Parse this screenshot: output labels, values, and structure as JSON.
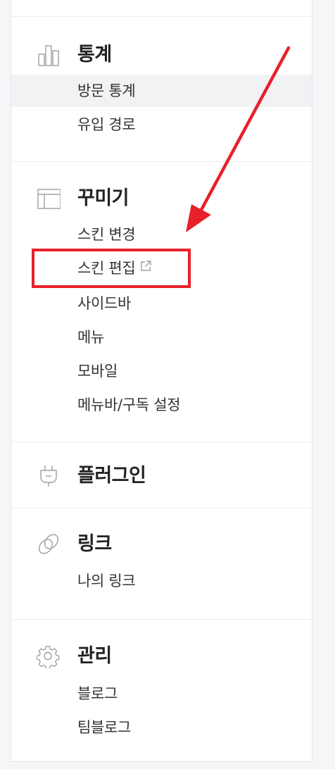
{
  "sections": [
    {
      "title": "통계",
      "icon": "bar-chart-icon",
      "items": [
        "방문 통계",
        "유입 경로"
      ]
    },
    {
      "title": "꾸미기",
      "icon": "layout-icon",
      "items": [
        "스킨 변경",
        "스킨 편집",
        "사이드바",
        "메뉴",
        "모바일",
        "메뉴바/구독 설정"
      ]
    },
    {
      "title": "플러그인",
      "icon": "plug-icon",
      "items": []
    },
    {
      "title": "링크",
      "icon": "link-icon",
      "items": [
        "나의 링크"
      ]
    },
    {
      "title": "관리",
      "icon": "gear-icon",
      "items": [
        "블로그",
        "팀블로그"
      ]
    }
  ],
  "colors": {
    "annotation": "#e8202a",
    "active_row": "#f1f2f4",
    "text": "#333333",
    "icon": "#9aa0a6"
  },
  "annotation": {
    "highlighted_item": "스킨 편집",
    "has_external_link_icon": true
  }
}
